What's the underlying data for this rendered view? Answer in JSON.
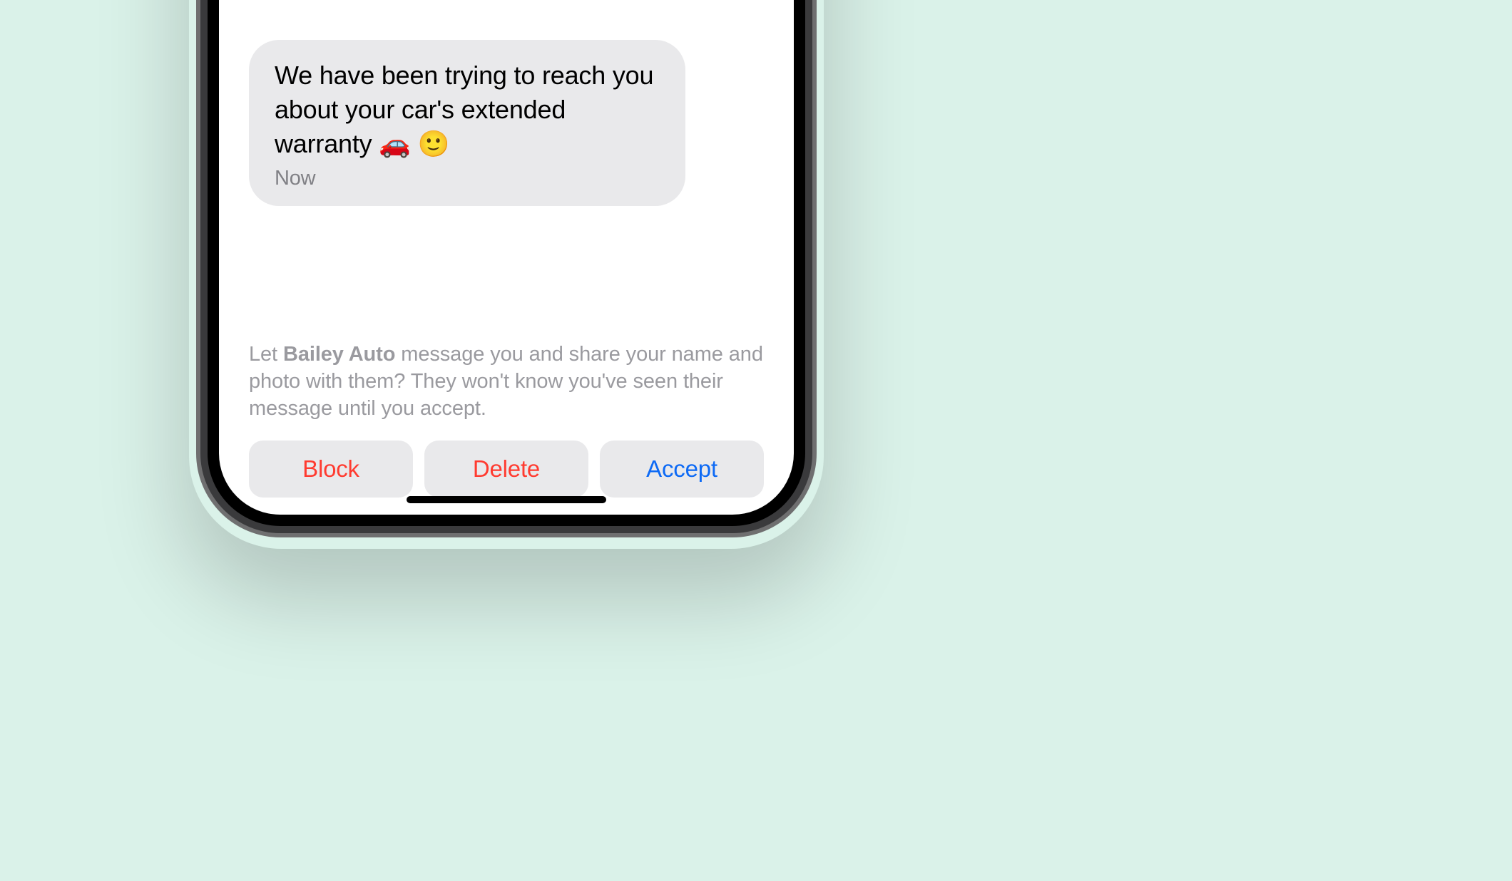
{
  "message": {
    "text": "We have been trying to reach you about your car's extended warranty 🚗 🙂",
    "timestamp": "Now"
  },
  "prompt": {
    "prefix": "Let ",
    "sender": "Bailey Auto",
    "suffix": " message you and share your name and photo with them? They won't know you've seen their message until you accept."
  },
  "actions": {
    "block": "Block",
    "delete": "Delete",
    "accept": "Accept"
  },
  "colors": {
    "destructive": "#ff3b30",
    "accent": "#0d6af5",
    "bubble_bg": "#e9e9eb"
  }
}
